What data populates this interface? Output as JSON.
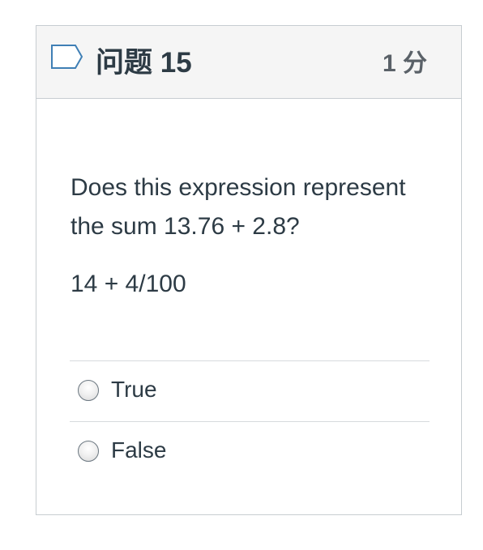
{
  "question": {
    "name": "问题 15",
    "points": "1 分",
    "text": "Does this expression represent the sum 13.76 + 2.8?",
    "expression": "14 + 4/100",
    "flag_icon": "flag-outline-icon"
  },
  "answers": [
    {
      "label": "True",
      "selected": false
    },
    {
      "label": "False",
      "selected": false
    }
  ],
  "colors": {
    "header_bg": "#f5f5f5",
    "border": "#c7cdd1",
    "text": "#2d3b45",
    "flag": "#3f7fb5"
  }
}
